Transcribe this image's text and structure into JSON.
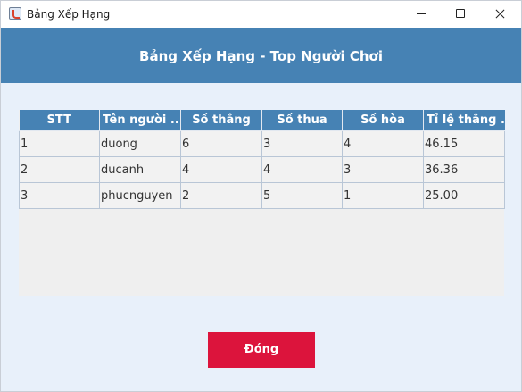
{
  "window": {
    "title": "Bảng Xếp Hạng",
    "icon": "java-cup-icon"
  },
  "header": {
    "title": "Bảng Xếp Hạng - Top Người Chơi"
  },
  "table": {
    "columns": [
      "STT",
      "Tên người ...",
      "Số thắng",
      "Số thua",
      "Số hòa",
      "Tỉ lệ thắng ..."
    ],
    "rows": [
      [
        "1",
        "duong",
        "6",
        "3",
        "4",
        "46.15"
      ],
      [
        "2",
        "ducanh",
        "4",
        "4",
        "3",
        "36.36"
      ],
      [
        "3",
        "phucnguyen",
        "2",
        "5",
        "1",
        "25.00"
      ]
    ]
  },
  "actions": {
    "close_label": "Đóng"
  },
  "colors": {
    "header_bg": "#4682b4",
    "table_header_bg": "#4682b4",
    "close_button_bg": "#dc143c",
    "content_bg": "#e8f0fa"
  }
}
